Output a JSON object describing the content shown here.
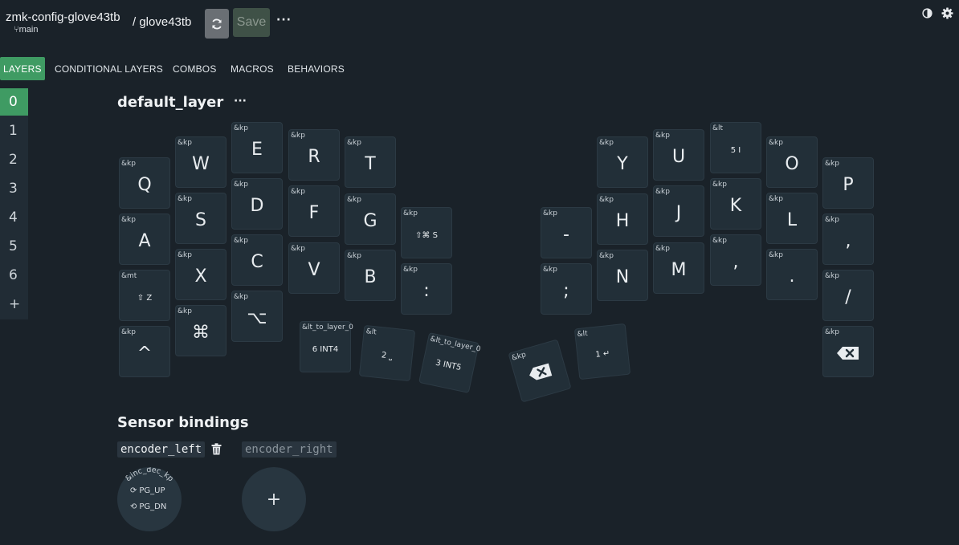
{
  "header": {
    "repo": "zmk-config-glove43tb",
    "branch": "main",
    "keymap": "/ glove43tb",
    "save_label": "Save",
    "more_label": "···"
  },
  "tabs": [
    {
      "label": "LAYERS",
      "active": true
    },
    {
      "label": "CONDITIONAL LAYERS"
    },
    {
      "label": "COMBOS"
    },
    {
      "label": "MACROS"
    },
    {
      "label": "BEHAVIORS"
    }
  ],
  "layers": [
    "0",
    "1",
    "2",
    "3",
    "4",
    "5",
    "6"
  ],
  "add_layer_label": "+",
  "layer_title": "default_layer",
  "layer_menu_label": "···",
  "keys": [
    {
      "b": "&kp",
      "l": "Q"
    },
    {
      "b": "&kp",
      "l": "W"
    },
    {
      "b": "&kp",
      "l": "E"
    },
    {
      "b": "&kp",
      "l": "R"
    },
    {
      "b": "&kp",
      "l": "T"
    },
    {
      "b": "&kp",
      "l": "Y"
    },
    {
      "b": "&kp",
      "l": "U"
    },
    {
      "b": "&lt",
      "l": "5 I"
    },
    {
      "b": "&kp",
      "l": "O"
    },
    {
      "b": "&kp",
      "l": "P"
    },
    {
      "b": "&kp",
      "l": "A"
    },
    {
      "b": "&kp",
      "l": "S"
    },
    {
      "b": "&kp",
      "l": "D"
    },
    {
      "b": "&kp",
      "l": "F"
    },
    {
      "b": "&kp",
      "l": "G"
    },
    {
      "b": "&kp",
      "l": "⇧⌘ S"
    },
    {
      "b": "&kp",
      "l": "-"
    },
    {
      "b": "&kp",
      "l": "H"
    },
    {
      "b": "&kp",
      "l": "J"
    },
    {
      "b": "&kp",
      "l": "K"
    },
    {
      "b": "&kp",
      "l": "L"
    },
    {
      "b": "&kp",
      "l": ","
    },
    {
      "b": "&mt",
      "l": "⇧ Z"
    },
    {
      "b": "&kp",
      "l": "X"
    },
    {
      "b": "&kp",
      "l": "C"
    },
    {
      "b": "&kp",
      "l": "V"
    },
    {
      "b": "&kp",
      "l": "B"
    },
    {
      "b": "&kp",
      "l": ":"
    },
    {
      "b": "&kp",
      "l": ";"
    },
    {
      "b": "&kp",
      "l": "N"
    },
    {
      "b": "&kp",
      "l": "M"
    },
    {
      "b": "&kp",
      "l": ","
    },
    {
      "b": "&kp",
      "l": "."
    },
    {
      "b": "&kp",
      "l": "/"
    },
    {
      "b": "&kp",
      "l": "^"
    },
    {
      "b": "&kp",
      "l": "⌘"
    },
    {
      "b": "&kp",
      "l": "⌥"
    },
    {
      "b": "&lt_to_layer_0",
      "l": "6 INT4"
    },
    {
      "b": "&lt",
      "l": "2 ⎵"
    },
    {
      "b": "&lt_to_layer_0",
      "l": "3 INT5"
    },
    {
      "b": "&kp",
      "l": "backspace-icon"
    },
    {
      "b": "&lt",
      "l": "1 ↵"
    },
    {
      "b": "&kp",
      "l": "backspace-icon"
    }
  ],
  "sensor": {
    "title": "Sensor bindings",
    "left_label": "encoder_left",
    "right_label": "encoder_right",
    "binding": "&inc_dec_kp",
    "cw": "PG_UP",
    "ccw": "PG_DN",
    "add_label": "+"
  },
  "colors": {
    "background": "#1a2229",
    "accent": "#3f9b63",
    "key": "#222f38"
  }
}
